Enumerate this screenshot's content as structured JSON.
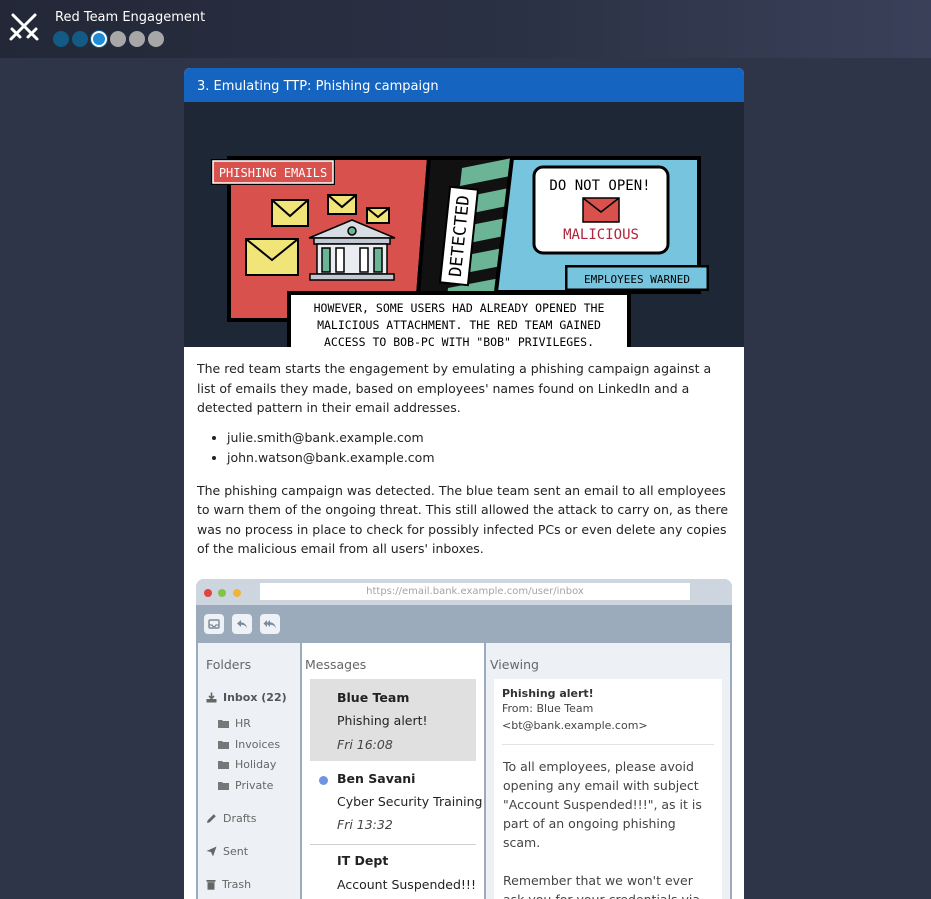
{
  "app": {
    "title": "Red Team Engagement",
    "icon": "crossed-swords-icon",
    "progress": {
      "total": 6,
      "completed": 2,
      "current": 3
    }
  },
  "colors": {
    "accent": "#1565c0",
    "progress_done": "#135a85",
    "progress_current": "#1d8bd6",
    "progress_todo": "#a7a7a7"
  },
  "card": {
    "title": "3. Emulating TTP: Phishing campaign",
    "comic": {
      "panel1_label": "PHISHING EMAILS",
      "detected": "DETECTED",
      "warning_line1": "DO NOT OPEN!",
      "warning_line2": "MALICIOUS",
      "panel3_label": "EMPLOYEES WARNED",
      "caption": "HOWEVER, SOME USERS HAD ALREADY OPENED THE MALICIOUS ATTACHMENT. THE RED TEAM GAINED ACCESS TO BOB-PC WITH \"BOB\" PRIVILEGES."
    },
    "intro": "The red team starts the engagement by emulating a phishing campaign against a list of emails they made, based on employees' names found on LinkedIn and a detected pattern in their email addresses.",
    "emails": [
      "julie.smith@bank.example.com",
      "john.watson@bank.example.com"
    ],
    "outcome": "The phishing campaign was detected. The blue team sent an email to all employees to warn them of the ongoing threat. This still allowed the attack to carry on, as there was no process in place to check for possibly infected PCs or even delete any copies of the malicious email from all users' inboxes."
  },
  "mail": {
    "url": "https://email.bank.example.com/user/inbox",
    "toolbar": [
      "inbox-icon",
      "reply-icon",
      "reply-all-icon"
    ],
    "folders_title": "Folders",
    "inbox_label": "Inbox (22)",
    "subfolders": [
      "HR",
      "Invoices",
      "Holiday",
      "Private"
    ],
    "drafts_label": "Drafts",
    "sent_label": "Sent",
    "trash_label": "Trash",
    "messages_title": "Messages",
    "messages": [
      {
        "from": "Blue Team",
        "subject": "Phishing alert!",
        "time": "Fri 16:08",
        "selected": true,
        "unread": false
      },
      {
        "from": "Ben Savani",
        "subject": "Cyber Security Training",
        "time": "Fri 13:32",
        "selected": false,
        "unread": true
      },
      {
        "from": "IT Dept",
        "subject": "Account Suspended!!!",
        "time": "",
        "selected": false,
        "unread": false
      }
    ],
    "viewing_title": "Viewing",
    "viewing": {
      "subject": "Phishing alert!",
      "from_line": "From: Blue Team",
      "from_address": "<bt@bank.example.com>",
      "paragraph1": "To all employees, please avoid opening any email with subject \"Account Suspended!!!\", as it is part of an ongoing phishing scam.",
      "paragraph2": "Remember that we won't ever ask you for your credentials via email."
    }
  }
}
